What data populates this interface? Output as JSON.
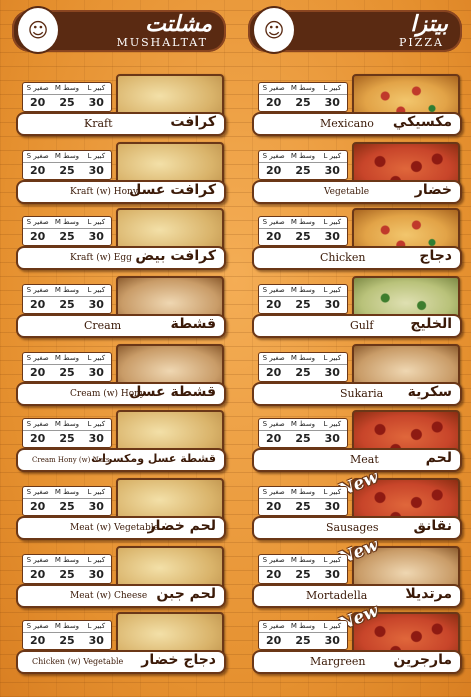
{
  "mushaltat": {
    "title_ar": "مشلتت",
    "title_en": "MUSHALTAT",
    "items": [
      {
        "name_ar": "كرافت",
        "name_en": "Kraft",
        "sizes": [
          "S صغير",
          "M وسط",
          "L كبير"
        ],
        "prices": [
          "20",
          "25",
          "30"
        ]
      },
      {
        "name_ar": "كرافت عسل",
        "name_en": "Kraft (w) Hony",
        "sizes": [
          "S صغير",
          "M وسط",
          "L كبير"
        ],
        "prices": [
          "20",
          "25",
          "30"
        ]
      },
      {
        "name_ar": "كرافت بيض",
        "name_en": "Kraft (w) Egg",
        "sizes": [
          "S صغير",
          "M وسط",
          "L كبير"
        ],
        "prices": [
          "20",
          "25",
          "30"
        ]
      },
      {
        "name_ar": "قشطة",
        "name_en": "Cream",
        "sizes": [
          "S صغير",
          "M وسط",
          "L كبير"
        ],
        "prices": [
          "20",
          "25",
          "30"
        ]
      },
      {
        "name_ar": "قشطة عسل",
        "name_en": "Cream (w) Hony",
        "sizes": [
          "S صغير",
          "M وسط",
          "L كبير"
        ],
        "prices": [
          "20",
          "25",
          "30"
        ]
      },
      {
        "name_ar": "قشطة عسل ومكسرات",
        "name_en": "Cream Hony (w) Nuts",
        "sizes": [
          "S صغير",
          "M وسط",
          "L كبير"
        ],
        "prices": [
          "20",
          "25",
          "30"
        ]
      },
      {
        "name_ar": "لحم خضار",
        "name_en": "Meat (w) Vegetable",
        "sizes": [
          "S صغير",
          "M وسط",
          "L كبير"
        ],
        "prices": [
          "20",
          "25",
          "30"
        ]
      },
      {
        "name_ar": "لحم جبن",
        "name_en": "Meat (w) Cheese",
        "sizes": [
          "S صغير",
          "M وسط",
          "L كبير"
        ],
        "prices": [
          "20",
          "25",
          "30"
        ]
      },
      {
        "name_ar": "دجاج خضار",
        "name_en": "Chicken (w) Vegetable",
        "sizes": [
          "S صغير",
          "M وسط",
          "L كبير"
        ],
        "prices": [
          "20",
          "25",
          "30"
        ]
      }
    ]
  },
  "pizza": {
    "title_ar": "بيتزا",
    "title_en": "PIZZA",
    "new_label": "New",
    "items": [
      {
        "name_ar": "مكسيكي",
        "name_en": "Mexicano",
        "sizes": [
          "S صغير",
          "M وسط",
          "L كبير"
        ],
        "prices": [
          "20",
          "25",
          "30"
        ]
      },
      {
        "name_ar": "خضار",
        "name_en": "Vegetable",
        "sizes": [
          "S صغير",
          "M وسط",
          "L كبير"
        ],
        "prices": [
          "20",
          "25",
          "30"
        ]
      },
      {
        "name_ar": "دجاج",
        "name_en": "Chicken",
        "sizes": [
          "S صغير",
          "M وسط",
          "L كبير"
        ],
        "prices": [
          "20",
          "25",
          "30"
        ]
      },
      {
        "name_ar": "الخليج",
        "name_en": "Gulf",
        "sizes": [
          "S صغير",
          "M وسط",
          "L كبير"
        ],
        "prices": [
          "20",
          "25",
          "30"
        ]
      },
      {
        "name_ar": "سكرية",
        "name_en": "Sukaria",
        "sizes": [
          "S صغير",
          "M وسط",
          "L كبير"
        ],
        "prices": [
          "20",
          "25",
          "30"
        ]
      },
      {
        "name_ar": "لحم",
        "name_en": "Meat",
        "sizes": [
          "S صغير",
          "M وسط",
          "L كبير"
        ],
        "prices": [
          "20",
          "25",
          "30"
        ]
      },
      {
        "name_ar": "نقانق",
        "name_en": "Sausages",
        "sizes": [
          "S صغير",
          "M وسط",
          "L كبير"
        ],
        "prices": [
          "20",
          "25",
          "30"
        ]
      },
      {
        "name_ar": "مرتديلا",
        "name_en": "Mortadella",
        "sizes": [
          "S صغير",
          "M وسط",
          "L كبير"
        ],
        "prices": [
          "20",
          "25",
          "30"
        ]
      },
      {
        "name_ar": "مارجرين",
        "name_en": "Margreen",
        "sizes": [
          "S صغير",
          "M وسط",
          "L كبير"
        ],
        "prices": [
          "20",
          "25",
          "30"
        ]
      }
    ]
  }
}
